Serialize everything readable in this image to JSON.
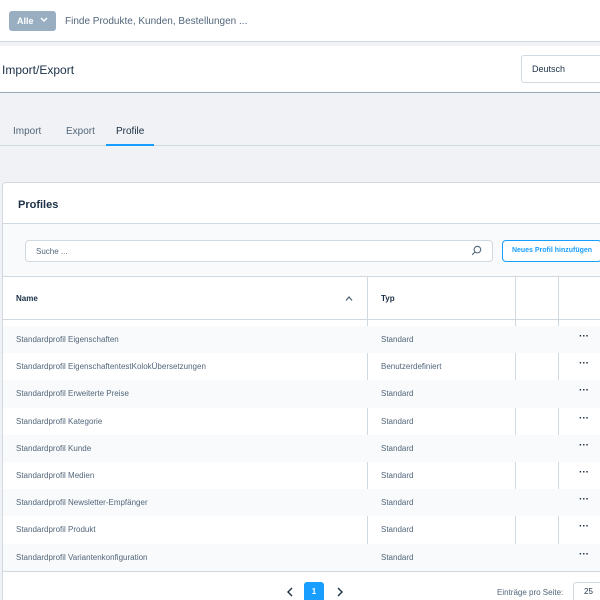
{
  "search": {
    "scope_label": "Alle",
    "placeholder": "Finde Produkte, Kunden, Bestellungen ..."
  },
  "header": {
    "title": "Import/Export",
    "language": "Deutsch"
  },
  "tabs": [
    {
      "label": "Import",
      "active": false
    },
    {
      "label": "Export",
      "active": false
    },
    {
      "label": "Profile",
      "active": true
    }
  ],
  "card": {
    "title": "Profiles",
    "search_placeholder": "Suche ...",
    "add_button": "Neues Profil hinzufügen"
  },
  "table": {
    "columns": [
      "Name",
      "Typ"
    ],
    "rows": [
      {
        "name": "Standardprofil Eigenschaften",
        "type": "Standard"
      },
      {
        "name": "Standardprofil EigenschaftentestKolokÜbersetzungen",
        "type": "Benutzerdefiniert"
      },
      {
        "name": "Standardprofil Erweiterte Preise",
        "type": "Standard"
      },
      {
        "name": "Standardprofil Kategorie",
        "type": "Standard"
      },
      {
        "name": "Standardprofil Kunde",
        "type": "Standard"
      },
      {
        "name": "Standardprofil Medien",
        "type": "Standard"
      },
      {
        "name": "Standardprofil Newsletter-Empfänger",
        "type": "Standard"
      },
      {
        "name": "Standardprofil Produkt",
        "type": "Standard"
      },
      {
        "name": "Standardprofil Variantenkonfiguration",
        "type": "Standard"
      }
    ],
    "row_menu": "···"
  },
  "pagination": {
    "current_page": "1",
    "per_page_label": "Einträge pro Seite:",
    "per_page_value": "25"
  },
  "colors": {
    "accent": "#189eff",
    "scope_button": "#9aaec2",
    "text_dark": "#1a2f45",
    "text": "#52667a"
  }
}
